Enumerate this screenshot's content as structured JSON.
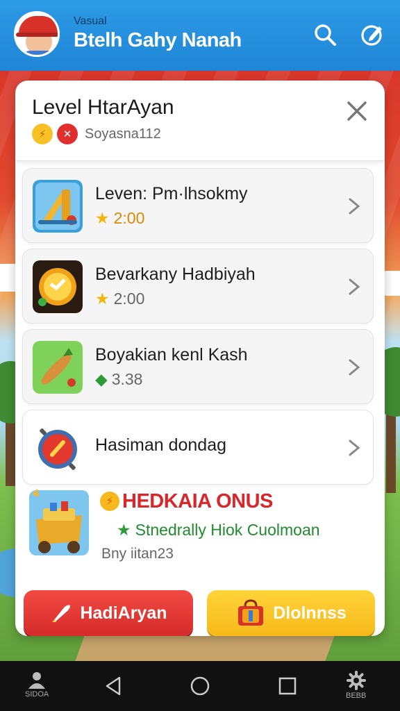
{
  "header": {
    "small_label": "Vasual",
    "title": "Btelh Gahy Nanah"
  },
  "card": {
    "title": "Level HtarAyan",
    "subtitle": "Soyasna112"
  },
  "items": [
    {
      "title": "Leven: Pm·lhsokmy",
      "value": "2:00",
      "meta_icon": "star-icon",
      "icon": "slide-game-icon"
    },
    {
      "title": "Bevarkany Hadbiyah",
      "value": "2:00",
      "meta_icon": "star-icon",
      "icon": "golden-coin-icon"
    },
    {
      "title": "Boyakian kenl Kash",
      "value": "3.38",
      "meta_icon": "gem-icon",
      "icon": "carrot-icon"
    },
    {
      "title": "Hasiman dondag",
      "icon": "red-orb-icon"
    }
  ],
  "bonus": {
    "title": "HEDKAIA ONUS",
    "subtitle": "Stnedrally Hiok Cuolmoan",
    "code": "Bny iitan23"
  },
  "buttons": {
    "primary": "HadiAryan",
    "secondary": "Dlolnnss"
  },
  "nav": {
    "left_label": "SIDOA",
    "right_label": "BEBB"
  },
  "colors": {
    "topbar": "#1f86d6",
    "bonus_title": "#d8262b",
    "bonus_sub": "#1f8b2d",
    "primary_button": "#e0332f",
    "secondary_button": "#f6b91a"
  }
}
